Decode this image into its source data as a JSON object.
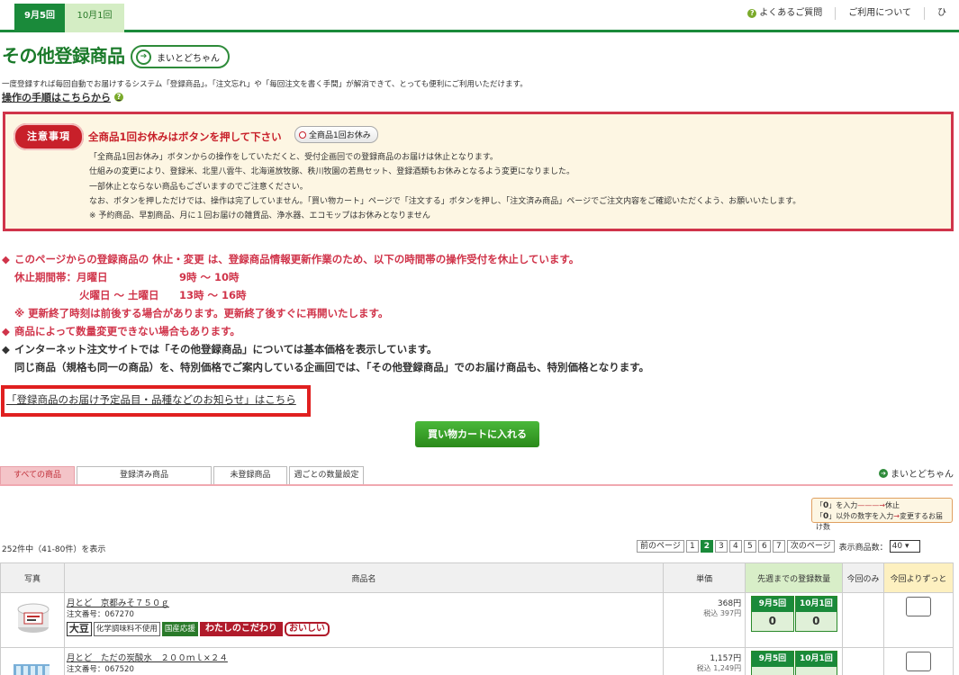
{
  "header": {
    "tabs": [
      {
        "label": "9月5回"
      },
      {
        "label": "10月1回"
      }
    ],
    "links": [
      {
        "label": "よくあるご質問"
      },
      {
        "label": "ご利用について"
      },
      {
        "label": "ひ"
      }
    ]
  },
  "page": {
    "title": "その他登録商品",
    "mytodo_label": "まいとどちゃん",
    "intro": "一度登録すれば毎回自動でお届けするシステム「登録商品」。「注文忘れ」や「毎回注文を書く手間」が解消できて、とっても便利にご利用いただけます。",
    "howto": "操作の手順はこちらから"
  },
  "notice": {
    "badge": "注意事項",
    "heading": "全商品1回お休みはボタンを押して下さい",
    "pause_all_button": "全商品1回お休み",
    "lines": [
      "「全商品1回お休み」ボタンからの操作をしていただくと、受付企画回での登録商品のお届けは休止となります。",
      "仕組みの変更により、登録米、北里八雲牛、北海道放牧豚、秩川牧園の若鳥セット、登録酒類もお休みとなるよう変更になりました。",
      "一部休止とならない商品もございますのでご注意ください。",
      "なお、ボタンを押しただけでは、操作は完了していません。「買い物カート」ページで「注文する」ボタンを押し、「注文済み商品」ページでご注文内容をご確認いただくよう、お願いいたします。",
      "※ 予約商品、早割商品、月に１回お届けの雑貨品、浄水器、エコモップはお休みとなりません"
    ]
  },
  "info": {
    "diamond": "◆",
    "line1": "このページからの登録商品の 休止・変更 は、登録商品情報更新作業のため、以下の時間帯の操作受付を休止しています。",
    "sched1_label": "休止期間帯：月曜日",
    "sched1_time": "9時 ～ 10時",
    "sched2_label": "火曜日 ～ 土曜日",
    "sched2_time": "13時 ～ 16時",
    "note": "※ 更新終了時刻は前後する場合があります。更新終了後すぐに再開いたします。",
    "line2": "商品によって数量変更できない場合もあります。",
    "line3": "インターネット注文サイトでは「その他登録商品」については基本価格を表示しています。",
    "line4": "同じ商品（規格も同一の商品）を、特別価格でご案内している企画回では、「その他登録商品」でのお届け商品も、特別価格となります。"
  },
  "schedule_link": "「登録商品のお届け予定品目・品種などのお知らせ」はこちら",
  "cart_button": "買い物カートに入れる",
  "tabs": [
    {
      "label": "すべての商品"
    },
    {
      "label": "登録済み商品"
    },
    {
      "label": "未登録商品"
    },
    {
      "label": "週ごとの数量設定"
    }
  ],
  "mytodo_link": "まいとどちゃん",
  "legend": {
    "zero": "0",
    "line1_a": "を入力",
    "line1_b": "休止",
    "line2_a": "以外の数字を入力",
    "line2_b": "変更するお届け数"
  },
  "list": {
    "count": "252件中（41-80件）を表示",
    "prev": "前のページ",
    "pages": [
      "1",
      "2",
      "3",
      "4",
      "5",
      "6",
      "7"
    ],
    "current_page": "2",
    "next": "次のページ",
    "perpage_label": "表示商品数：",
    "perpage_value": "40"
  },
  "table": {
    "headers": {
      "photo": "写真",
      "name": "商品名",
      "price": "単価",
      "registered": "先週までの登録数量",
      "once": "今回のみ",
      "from_now": "今回よりずっと"
    },
    "rows": [
      {
        "name": "月とど　京都みそ７５０ｇ",
        "code": "注文番号：067270",
        "price": "368円",
        "tax": "税込 397円",
        "badges": [
          "大豆",
          "化学調味料不使用",
          "国産応援",
          "わたしのこだわり",
          "おいしい"
        ],
        "q1_label": "9月5回",
        "q1": "0",
        "q2_label": "10月1回",
        "q2": "0"
      },
      {
        "name": "月とど　ただの炭酸水　２００ｍｌ×２４",
        "code": "注文番号：067520",
        "price": "1,157円",
        "tax": "税込 1,249円",
        "q1_label": "9月5回",
        "q2_label": "10月1回"
      }
    ]
  }
}
